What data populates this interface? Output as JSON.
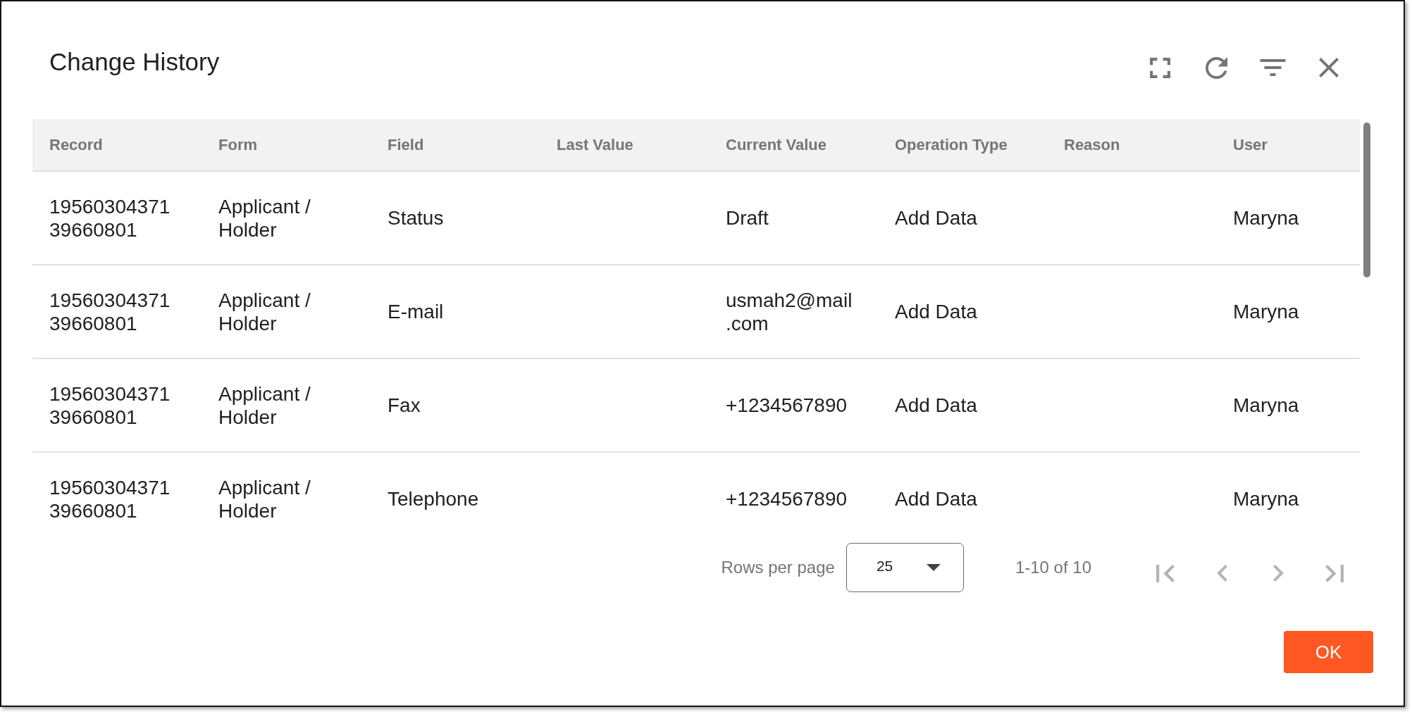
{
  "dialog": {
    "title": "Change History"
  },
  "table": {
    "columns": [
      "Record",
      "Form",
      "Field",
      "Last Value",
      "Current Value",
      "Operation Type",
      "Reason",
      "User"
    ],
    "rows": [
      {
        "record": "1956030437139660801",
        "form": "Applicant / Holder",
        "field": "Status",
        "current_value": "Draft",
        "operation_type": "Add Data",
        "user": "Maryna"
      },
      {
        "record": "1956030437139660801",
        "form": "Applicant / Holder",
        "field": "E-mail",
        "current_value": "usmah2@mail.com",
        "operation_type": "Add Data",
        "user": "Maryna"
      },
      {
        "record": "1956030437139660801",
        "form": "Applicant / Holder",
        "field": "Fax",
        "current_value": "+1234567890",
        "operation_type": "Add Data",
        "user": "Maryna"
      },
      {
        "record": "1956030437139660801",
        "form": "Applicant / Holder",
        "field": "Telephone",
        "current_value": "+1234567890",
        "operation_type": "Add Data",
        "user": "Maryna"
      }
    ]
  },
  "pagination": {
    "rows_per_page_label": "Rows per page",
    "rows_per_page": "25",
    "range": "1-10 of 10",
    "nav": [
      {
        "kind": "first",
        "disabled": true
      },
      {
        "kind": "previous",
        "disabled": true
      },
      {
        "kind": "next",
        "disabled": true
      },
      {
        "kind": "last",
        "disabled": true
      }
    ]
  },
  "ok_button": "OK"
}
